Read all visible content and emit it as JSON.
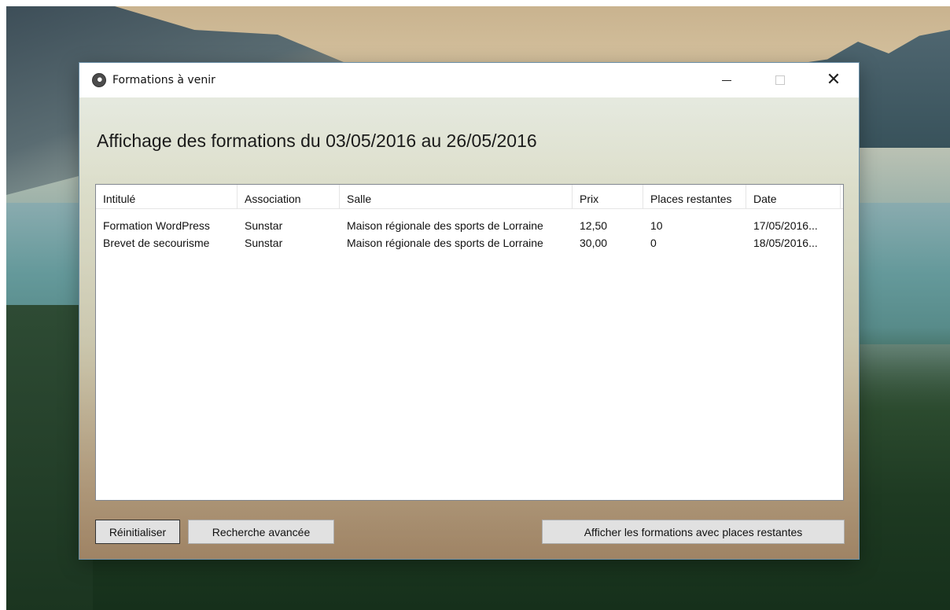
{
  "window": {
    "title": "Formations à venir",
    "controls": {
      "minimize": "—",
      "maximize": "☐",
      "close": "✕"
    }
  },
  "heading": "Affichage des formations du 03/05/2016 au 26/05/2016",
  "table": {
    "columns": [
      "Intitulé",
      "Association",
      "Salle",
      "Prix",
      "Places restantes",
      "Date"
    ],
    "rows": [
      [
        "Formation WordPress",
        "Sunstar",
        "Maison régionale des sports de Lorraine",
        "12,50",
        "10",
        "17/05/2016..."
      ],
      [
        "Brevet de secourisme",
        "Sunstar",
        "Maison régionale des sports de Lorraine",
        "30,00",
        "0",
        "18/05/2016..."
      ]
    ]
  },
  "buttons": {
    "reset": "Réinitialiser",
    "advanced_search": "Recherche avancée",
    "show_available": "Afficher les formations avec places restantes"
  },
  "icons": {
    "app": "app-logo-icon",
    "minimize": "minimize-icon",
    "maximize": "maximize-icon",
    "close": "close-icon"
  }
}
